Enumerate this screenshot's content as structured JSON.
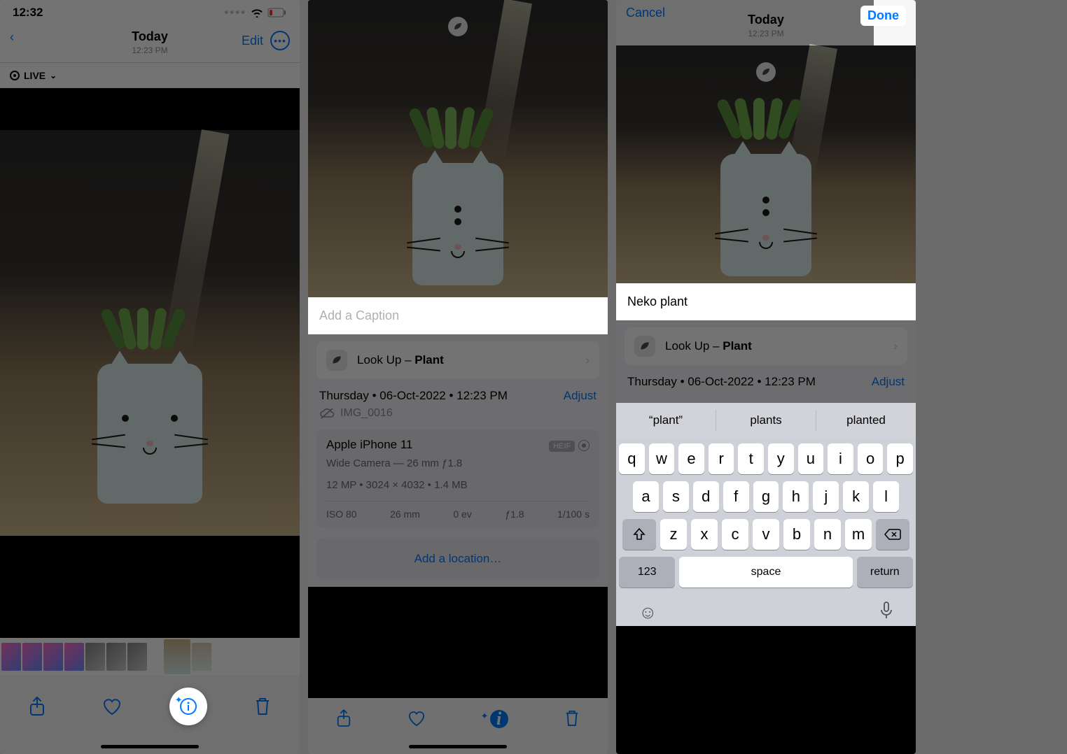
{
  "screen1": {
    "statusbar": {
      "time": "12:32"
    },
    "header": {
      "title": "Today",
      "subtitle": "12:23 PM",
      "edit": "Edit"
    },
    "live_label": "LIVE"
  },
  "screen2": {
    "caption_placeholder": "Add a Caption",
    "lookup": {
      "prefix": "Look Up – ",
      "subject": "Plant"
    },
    "datetime": "Thursday • 06-Oct-2022 • 12:23 PM",
    "adjust": "Adjust",
    "filename": "IMG_0016",
    "device": {
      "model": "Apple iPhone 11",
      "format_badge": "HEIF",
      "lens_line": "Wide Camera — 26 mm ƒ1.8",
      "res_line": "12 MP  •  3024 × 4032  •  1.4 MB",
      "exif": {
        "iso": "ISO 80",
        "focal": "26 mm",
        "ev": "0 ev",
        "aperture": "ƒ1.8",
        "shutter": "1/100 s"
      }
    },
    "add_location": "Add a location…"
  },
  "screen3": {
    "header": {
      "title": "Today",
      "subtitle": "12:23 PM",
      "cancel": "Cancel",
      "done": "Done"
    },
    "caption_value": "Neko plant",
    "lookup": {
      "prefix": "Look Up – ",
      "subject": "Plant"
    },
    "datetime": "Thursday • 06-Oct-2022 • 12:23 PM",
    "adjust": "Adjust",
    "suggestions": [
      "“plant”",
      "plants",
      "planted"
    ],
    "keyboard": {
      "row1": [
        "q",
        "w",
        "e",
        "r",
        "t",
        "y",
        "u",
        "i",
        "o",
        "p"
      ],
      "row2": [
        "a",
        "s",
        "d",
        "f",
        "g",
        "h",
        "j",
        "k",
        "l"
      ],
      "row3": [
        "z",
        "x",
        "c",
        "v",
        "b",
        "n",
        "m"
      ],
      "num": "123",
      "space": "space",
      "return": "return"
    }
  }
}
